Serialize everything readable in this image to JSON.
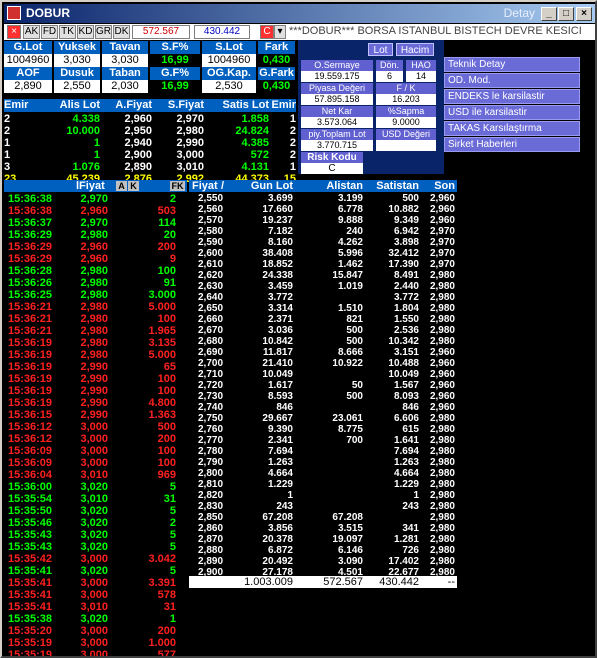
{
  "window": {
    "title": "DOBUR",
    "detail_label": "Detay"
  },
  "toolbar": {
    "buttons": [
      "AK",
      "FD",
      "TK",
      "KD",
      "GR",
      "DK"
    ],
    "value1": "572.567",
    "value2": "430.442",
    "c_label": "C",
    "ticker": "***DOBUR*** BORSA ISTANBUL BISTECH DEVRE KESICI"
  },
  "summary": {
    "headers1": [
      "G.Lot",
      "Yuksek",
      "Tavan",
      "S.F%",
      "S.Lot",
      "Fark"
    ],
    "values1": [
      "1004960",
      "3,030",
      "3,030",
      "16,99",
      "1004960",
      "0,430"
    ],
    "headers2": [
      "AOF",
      "Dusuk",
      "Taban",
      "G.F%",
      "OG.Kap.",
      "G.Fark"
    ],
    "values2": [
      "2,890",
      "2,550",
      "2,030",
      "16,99",
      "2,530",
      "0,430"
    ]
  },
  "panel": {
    "tabs": [
      "Lot",
      "Hacim"
    ],
    "o_sermaye_label": "O.Sermaye",
    "o_sermaye": "19.559.175",
    "don_label": "Dön.",
    "don": "6",
    "hao_label": "HAO",
    "hao": "14",
    "piyasa_label": "Piyasa Değeri",
    "piyasa": "57.895.158",
    "fk_label": "F / K",
    "fk": "16.203",
    "netkar_label": "Net Kar",
    "netkar": "3.573.064",
    "sapma_label": "%Sapma",
    "sapma": "9.0000",
    "piytop_label": "piy.Toplam Lot",
    "piytop": "3.770.715",
    "usd_label": "USD Değeri",
    "risk_label": "Risk Kodu",
    "risk": "C"
  },
  "menu": [
    "Teknik Detay",
    "OD. Mod.",
    "ENDEKS le karsilastir",
    "USD ile karsilastir",
    "TAKAS Karsılaştırma",
    "Sirket Haberleri"
  ],
  "depth": {
    "headers": [
      "Emir",
      "Alis Lot",
      "A.Fiyat",
      "S.Fiyat",
      "Satis Lot",
      "Emir"
    ],
    "rows": [
      [
        "2",
        "4.338",
        "2,960",
        "2,970",
        "1.858",
        "1"
      ],
      [
        "2",
        "10.000",
        "2,950",
        "2,980",
        "24.824",
        "2"
      ],
      [
        "1",
        "1",
        "2,940",
        "2,990",
        "4.385",
        "2"
      ],
      [
        "1",
        "1",
        "2,900",
        "3,000",
        "572",
        "2"
      ],
      [
        "3",
        "1.076",
        "2,890",
        "3,010",
        "4.131",
        "1"
      ],
      [
        "23",
        "45.239",
        "2,876",
        "2,992",
        "44.373",
        "15"
      ]
    ]
  },
  "trades": {
    "headers": [
      "lFiyat",
      "A",
      "K",
      "FK"
    ],
    "rows": [
      [
        "15:36:38",
        "2,970",
        "2",
        "g"
      ],
      [
        "15:36:38",
        "2,960",
        "503",
        "r"
      ],
      [
        "15:36:37",
        "2,970",
        "114",
        "g"
      ],
      [
        "15:36:29",
        "2,980",
        "20",
        "g"
      ],
      [
        "15:36:29",
        "2,960",
        "200",
        "r"
      ],
      [
        "15:36:29",
        "2,960",
        "9",
        "r"
      ],
      [
        "15:36:28",
        "2,980",
        "100",
        "g"
      ],
      [
        "15:36:26",
        "2,980",
        "91",
        "g"
      ],
      [
        "15:36:25",
        "2,980",
        "3.000",
        "g"
      ],
      [
        "15:36:21",
        "2,980",
        "5.000",
        "r"
      ],
      [
        "15:36:21",
        "2,980",
        "100",
        "r"
      ],
      [
        "15:36:21",
        "2,980",
        "1.965",
        "r"
      ],
      [
        "15:36:19",
        "2,980",
        "3.135",
        "r"
      ],
      [
        "15:36:19",
        "2,980",
        "5.000",
        "r"
      ],
      [
        "15:36:19",
        "2,990",
        "65",
        "r"
      ],
      [
        "15:36:19",
        "2,990",
        "100",
        "r"
      ],
      [
        "15:36:19",
        "2,990",
        "100",
        "r"
      ],
      [
        "15:36:19",
        "2,990",
        "4.800",
        "r"
      ],
      [
        "15:36:15",
        "2,990",
        "1.363",
        "r"
      ],
      [
        "15:36:12",
        "3,000",
        "500",
        "r"
      ],
      [
        "15:36:12",
        "3,000",
        "200",
        "r"
      ],
      [
        "15:36:09",
        "3,000",
        "100",
        "r"
      ],
      [
        "15:36:09",
        "3,000",
        "100",
        "r"
      ],
      [
        "15:36:04",
        "3,010",
        "969",
        "r"
      ],
      [
        "15:36:00",
        "3,020",
        "5",
        "g"
      ],
      [
        "15:35:54",
        "3,010",
        "31",
        "g"
      ],
      [
        "15:35:50",
        "3,020",
        "5",
        "g"
      ],
      [
        "15:35:46",
        "3,020",
        "2",
        "g"
      ],
      [
        "15:35:43",
        "3,020",
        "5",
        "g"
      ],
      [
        "15:35:43",
        "3,020",
        "5",
        "g"
      ],
      [
        "15:35:42",
        "3,000",
        "3.042",
        "r"
      ],
      [
        "15:35:41",
        "3,020",
        "5",
        "g"
      ],
      [
        "15:35:41",
        "3,000",
        "3.391",
        "r"
      ],
      [
        "15:35:41",
        "3,000",
        "578",
        "r"
      ],
      [
        "15:35:41",
        "3,010",
        "31",
        "r"
      ],
      [
        "15:35:38",
        "3,020",
        "1",
        "g"
      ],
      [
        "15:35:20",
        "3,000",
        "200",
        "r"
      ],
      [
        "15:35:19",
        "3,000",
        "1.000",
        "r"
      ],
      [
        "15:35:19",
        "3,000",
        "577",
        "r"
      ]
    ]
  },
  "distribution": {
    "headers": [
      "Fiyat",
      "Gun Lot",
      "Alistan",
      "Satistan",
      "Son"
    ],
    "rows": [
      [
        "2,550",
        "3.699",
        "3.199",
        "500",
        "2,960"
      ],
      [
        "2,560",
        "17.660",
        "6.778",
        "10.882",
        "2,960"
      ],
      [
        "2,570",
        "19.237",
        "9.888",
        "9.349",
        "2,960"
      ],
      [
        "2,580",
        "7.182",
        "240",
        "6.942",
        "2,970"
      ],
      [
        "2,590",
        "8.160",
        "4.262",
        "3.898",
        "2,970"
      ],
      [
        "2,600",
        "38.408",
        "5.996",
        "32.412",
        "2,970"
      ],
      [
        "2,610",
        "18.852",
        "1.462",
        "17.390",
        "2,970"
      ],
      [
        "2,620",
        "24.338",
        "15.847",
        "8.491",
        "2,980"
      ],
      [
        "2,630",
        "3.459",
        "1.019",
        "2.440",
        "2,980"
      ],
      [
        "2,640",
        "3.772",
        "",
        "3.772",
        "2,980"
      ],
      [
        "2,650",
        "3.314",
        "1.510",
        "1.804",
        "2,980"
      ],
      [
        "2,660",
        "2.371",
        "821",
        "1.550",
        "2,980"
      ],
      [
        "2,670",
        "3.036",
        "500",
        "2.536",
        "2,980"
      ],
      [
        "2,680",
        "10.842",
        "500",
        "10.342",
        "2,980"
      ],
      [
        "2,690",
        "11.817",
        "8.666",
        "3.151",
        "2,960"
      ],
      [
        "2,700",
        "21.410",
        "10.922",
        "10.488",
        "2,960"
      ],
      [
        "2,710",
        "10.049",
        "",
        "10.049",
        "2,960"
      ],
      [
        "2,720",
        "1.617",
        "50",
        "1.567",
        "2,960"
      ],
      [
        "2,730",
        "8.593",
        "500",
        "8.093",
        "2,960"
      ],
      [
        "2,740",
        "846",
        "",
        "846",
        "2,960"
      ],
      [
        "2,750",
        "29.667",
        "23.061",
        "6.606",
        "2,980"
      ],
      [
        "2,760",
        "9.390",
        "8.775",
        "615",
        "2,980"
      ],
      [
        "2,770",
        "2.341",
        "700",
        "1.641",
        "2,980"
      ],
      [
        "2,780",
        "7.694",
        "",
        "7.694",
        "2,980"
      ],
      [
        "2,790",
        "1.263",
        "",
        "1.263",
        "2,980"
      ],
      [
        "2,800",
        "4.664",
        "",
        "4.664",
        "2,980"
      ],
      [
        "2,810",
        "1.229",
        "",
        "1.229",
        "2,980"
      ],
      [
        "2,820",
        "1",
        "",
        "1",
        "2,980"
      ],
      [
        "2,830",
        "243",
        "",
        "243",
        "2,980"
      ],
      [
        "2,850",
        "67.208",
        "67.208",
        "",
        "2,980"
      ],
      [
        "2,860",
        "3.856",
        "3.515",
        "341",
        "2,980"
      ],
      [
        "2,870",
        "20.378",
        "19.097",
        "1.281",
        "2,980"
      ],
      [
        "2,880",
        "6.872",
        "6.146",
        "726",
        "2,980"
      ],
      [
        "2,890",
        "20.492",
        "3.090",
        "17.402",
        "2,980"
      ],
      [
        "2,900",
        "27.178",
        "4.501",
        "22.677",
        "2,980"
      ]
    ],
    "totals": [
      "1.003.009",
      "572.567",
      "430.442",
      "--"
    ]
  },
  "colors": {
    "up": "#00ff00",
    "down": "#ff2020",
    "header": "#0060c0",
    "background": "#000000"
  }
}
